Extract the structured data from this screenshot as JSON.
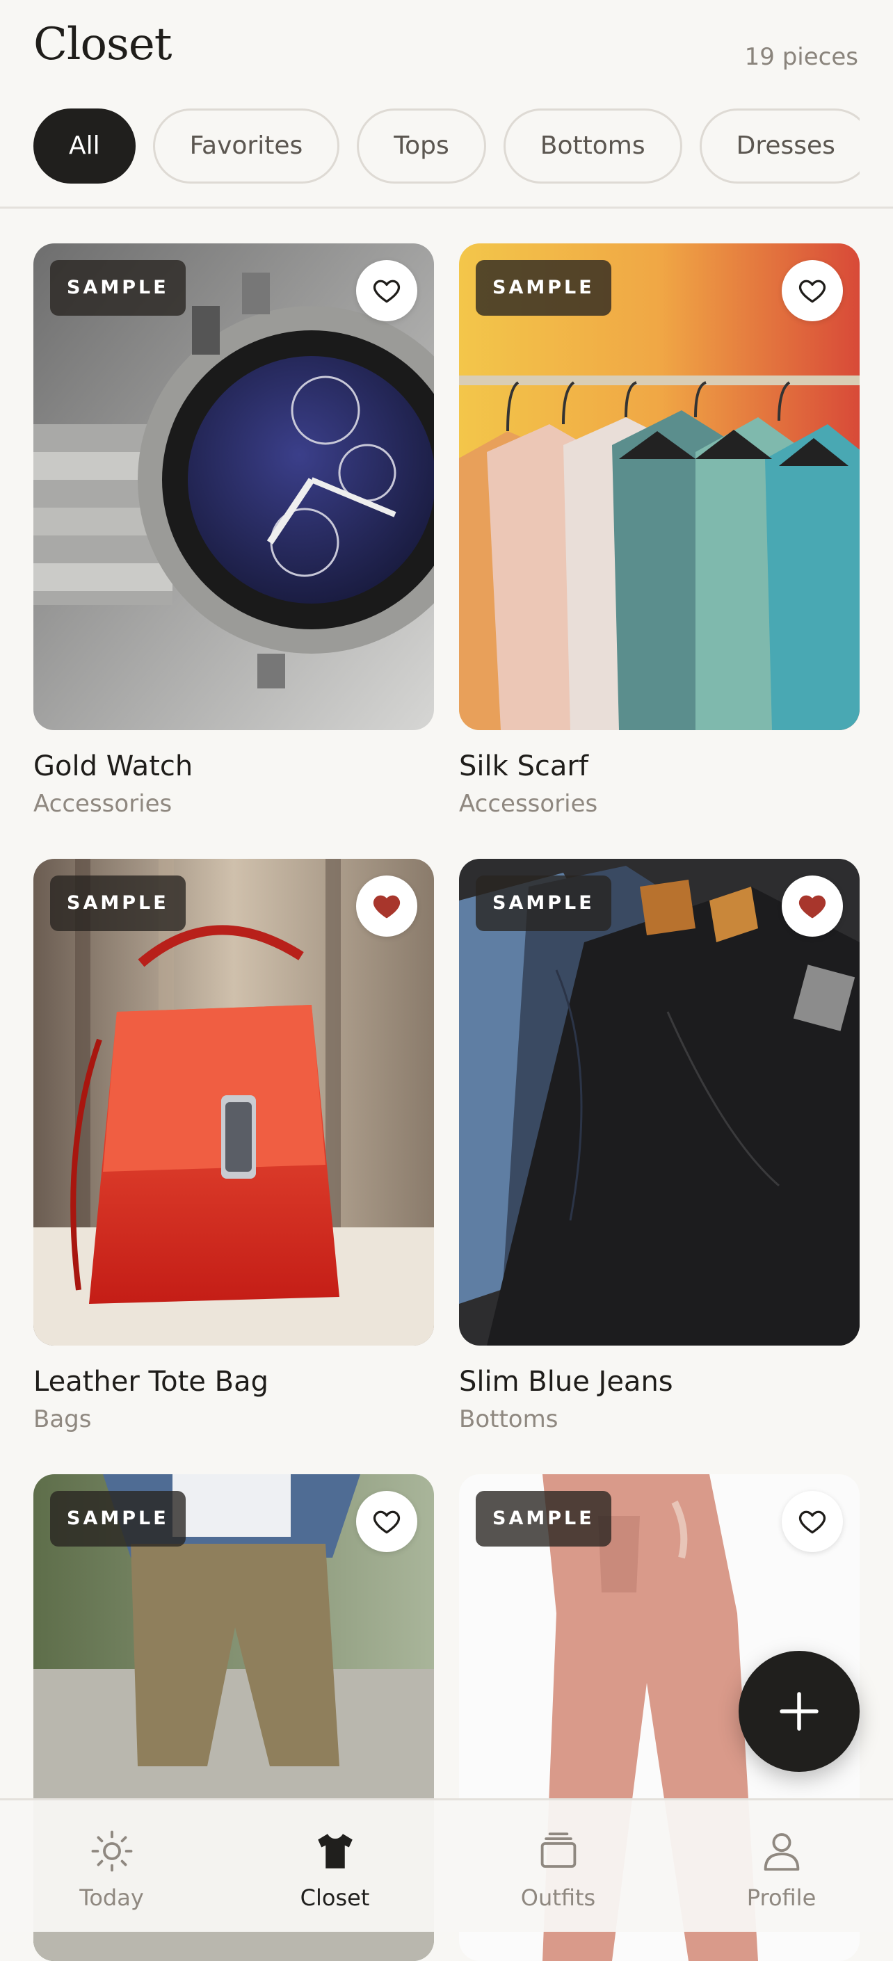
{
  "header": {
    "title": "Closet",
    "count": "19 pieces"
  },
  "filters": [
    {
      "label": "All",
      "active": true
    },
    {
      "label": "Favorites",
      "active": false
    },
    {
      "label": "Tops",
      "active": false
    },
    {
      "label": "Bottoms",
      "active": false
    },
    {
      "label": "Dresses",
      "active": false
    }
  ],
  "items": [
    {
      "name": "Gold Watch",
      "category": "Accessories",
      "badge": "SAMPLE",
      "favorited": false
    },
    {
      "name": "Silk Scarf",
      "category": "Accessories",
      "badge": "SAMPLE",
      "favorited": false
    },
    {
      "name": "Leather Tote Bag",
      "category": "Bags",
      "badge": "SAMPLE",
      "favorited": true
    },
    {
      "name": "Slim Blue Jeans",
      "category": "Bottoms",
      "badge": "SAMPLE",
      "favorited": true
    },
    {
      "name": "",
      "category": "",
      "badge": "SAMPLE",
      "favorited": false
    },
    {
      "name": "",
      "category": "",
      "badge": "SAMPLE",
      "favorited": false
    }
  ],
  "fab": {
    "icon": "plus-icon"
  },
  "nav": [
    {
      "label": "Today",
      "icon": "sun-icon",
      "active": false
    },
    {
      "label": "Closet",
      "icon": "tshirt-icon",
      "active": true
    },
    {
      "label": "Outfits",
      "icon": "layers-icon",
      "active": false
    },
    {
      "label": "Profile",
      "icon": "person-icon",
      "active": false
    }
  ],
  "colors": {
    "background": "#f8f7f4",
    "primary": "#201f1d",
    "muted": "#8f8880",
    "favorite": "#a8362c"
  }
}
